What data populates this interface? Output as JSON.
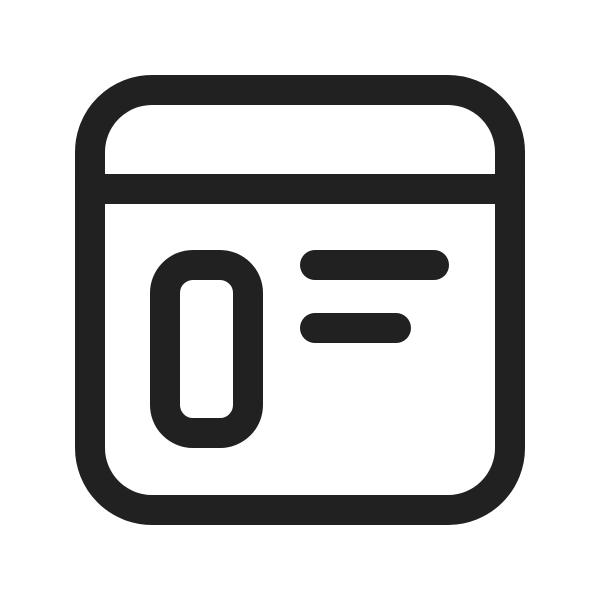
{
  "icon": {
    "name": "app-window-layout-icon",
    "stroke_color": "#212121",
    "background_color": "#ffffff"
  }
}
